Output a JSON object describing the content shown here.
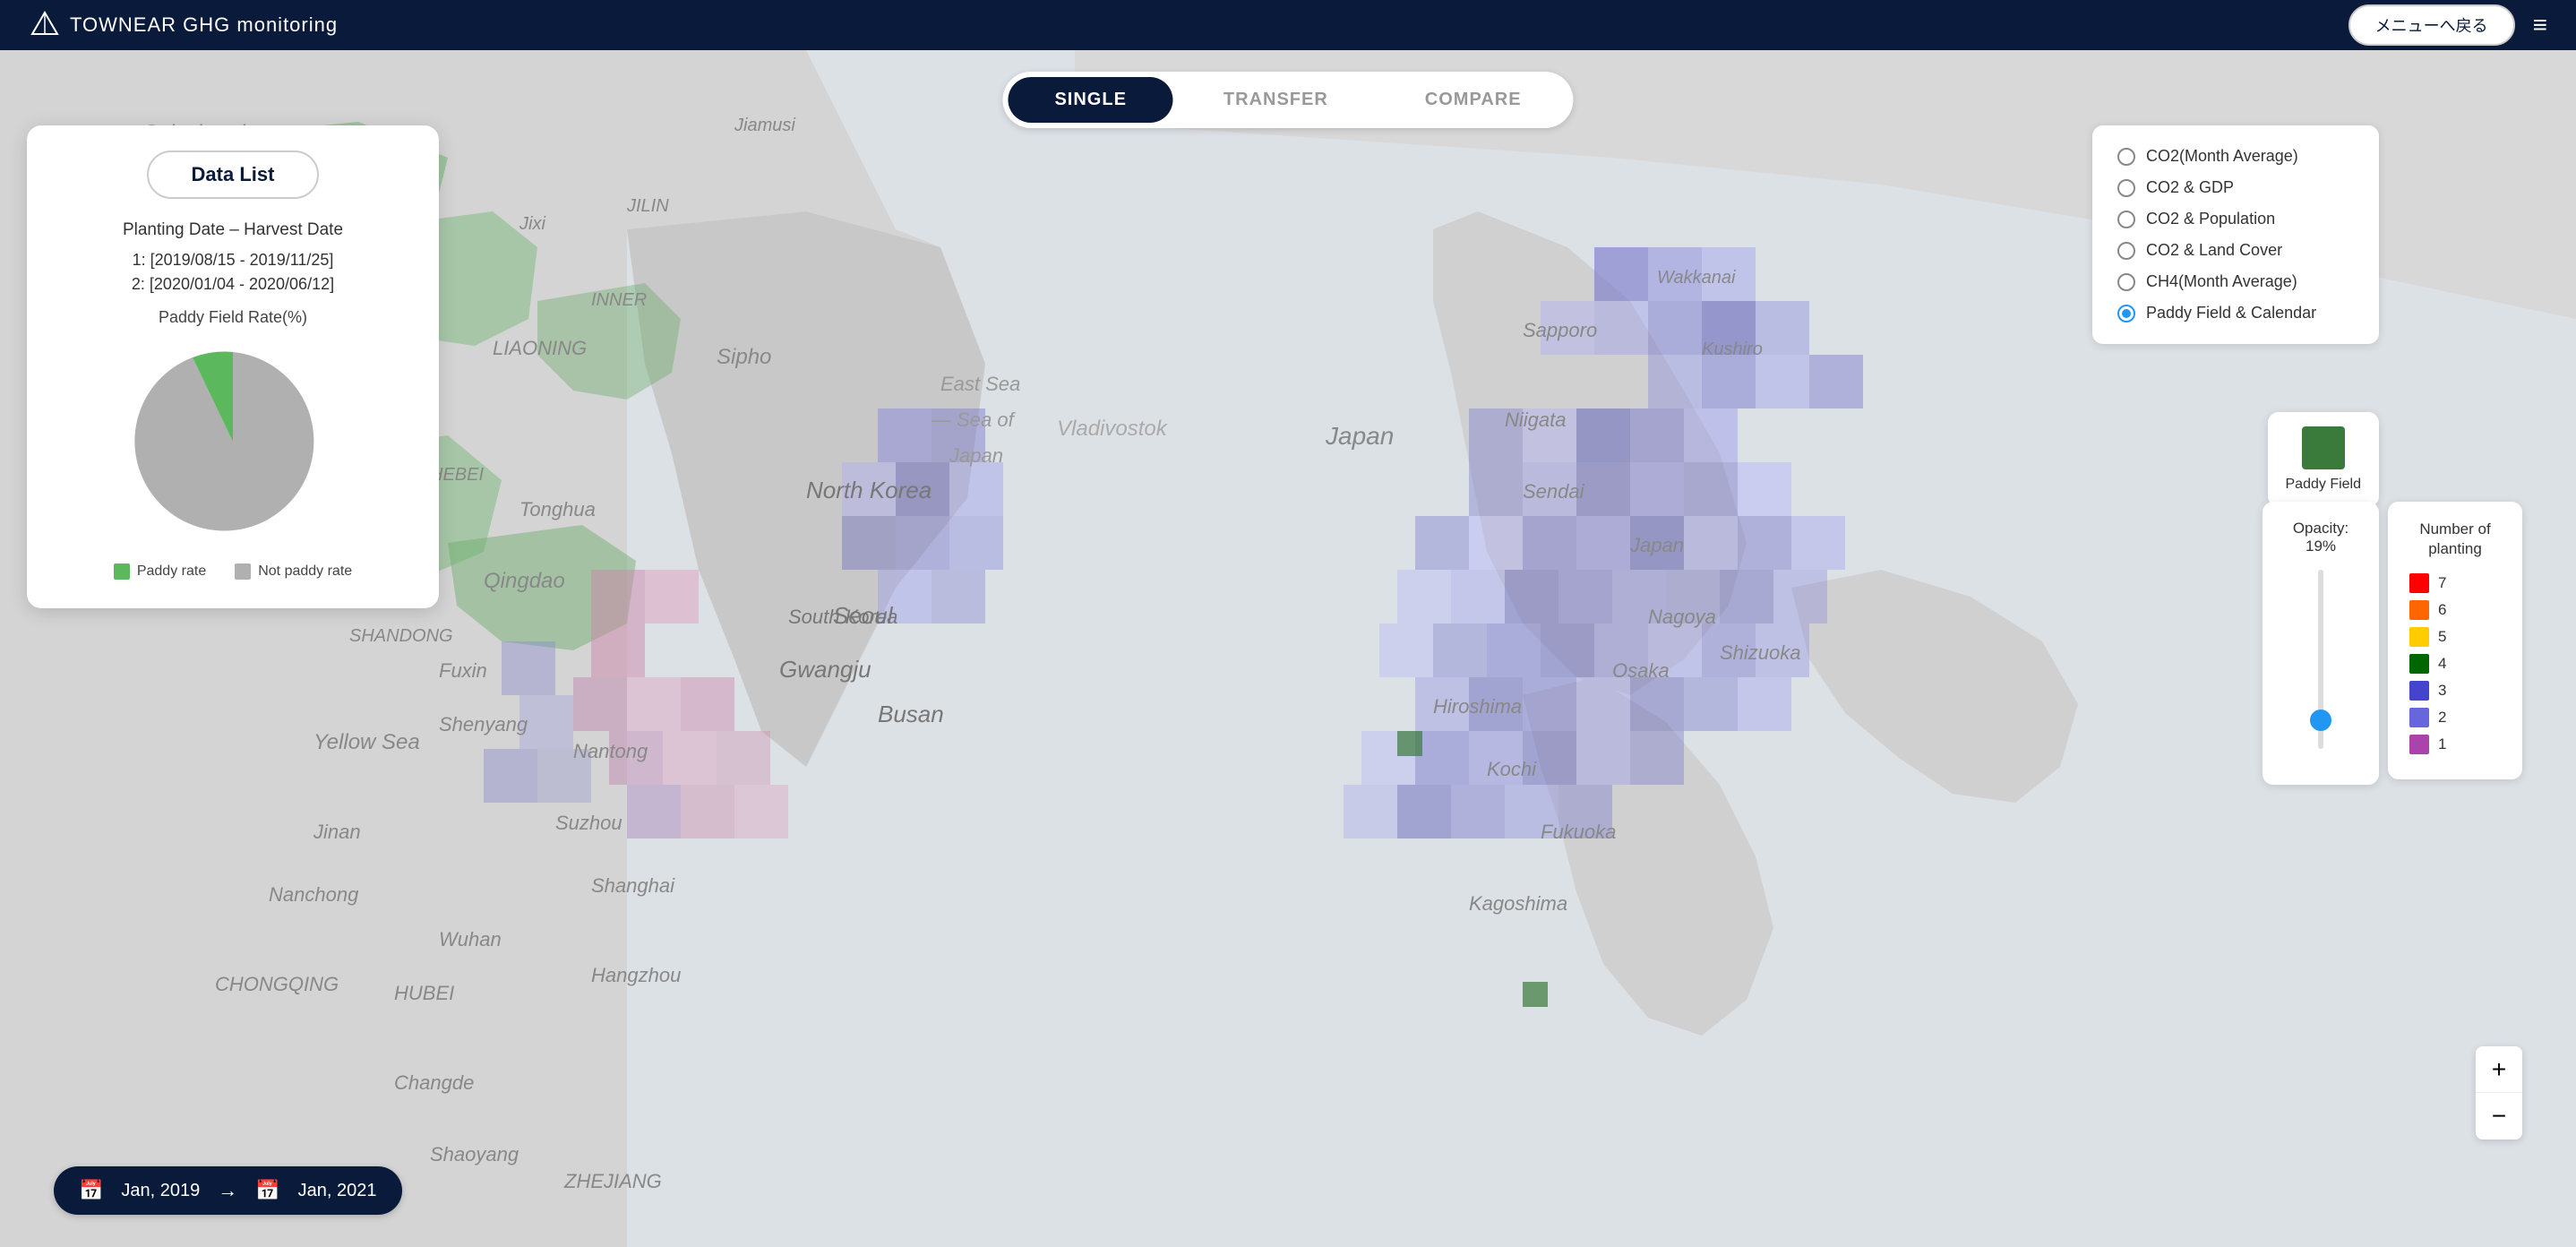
{
  "header": {
    "logo_text": "TOWNEAR GHG monitoring",
    "menu_button": "メニューへ戻る",
    "hamburger": "≡"
  },
  "tabs": {
    "items": [
      {
        "label": "SINGLE",
        "active": true
      },
      {
        "label": "TRANSFER",
        "active": false
      },
      {
        "label": "COMPARE",
        "active": false
      }
    ]
  },
  "data_list_panel": {
    "title": "Data List",
    "planting_harvest": "Planting Date – Harvest Date",
    "date1": "1: [2019/08/15 - 2019/11/25]",
    "date2": "2: [2020/01/04 - 2020/06/12]",
    "paddy_rate_label": "Paddy Field Rate(%)",
    "legend": {
      "paddy": "Paddy rate",
      "not_paddy": "Not paddy rate"
    }
  },
  "radio_options": [
    {
      "label": "CO2(Month Average)",
      "selected": false
    },
    {
      "label": "CO2 & GDP",
      "selected": false
    },
    {
      "label": "CO2 & Population",
      "selected": false
    },
    {
      "label": "CO2 & Land Cover",
      "selected": false
    },
    {
      "label": "CH4(Month Average)",
      "selected": false
    },
    {
      "label": "Paddy Field & Calendar",
      "selected": true
    }
  ],
  "paddy_field_legend": {
    "label": "Paddy Field"
  },
  "opacity_panel": {
    "label": "Opacity: 19%"
  },
  "planting_panel": {
    "label": "Number of planting",
    "items": [
      {
        "color": "#ff0000",
        "value": "7"
      },
      {
        "color": "#ff6600",
        "value": "6"
      },
      {
        "color": "#ffcc00",
        "value": "5"
      },
      {
        "color": "#006600",
        "value": "4"
      },
      {
        "color": "#4444cc",
        "value": "3"
      },
      {
        "color": "#6666dd",
        "value": "2"
      },
      {
        "color": "#aa44aa",
        "value": "1"
      }
    ]
  },
  "zoom": {
    "plus": "+",
    "minus": "−"
  },
  "date_bar": {
    "start_date": "Jan, 2019",
    "end_date": "Jan, 2021"
  }
}
